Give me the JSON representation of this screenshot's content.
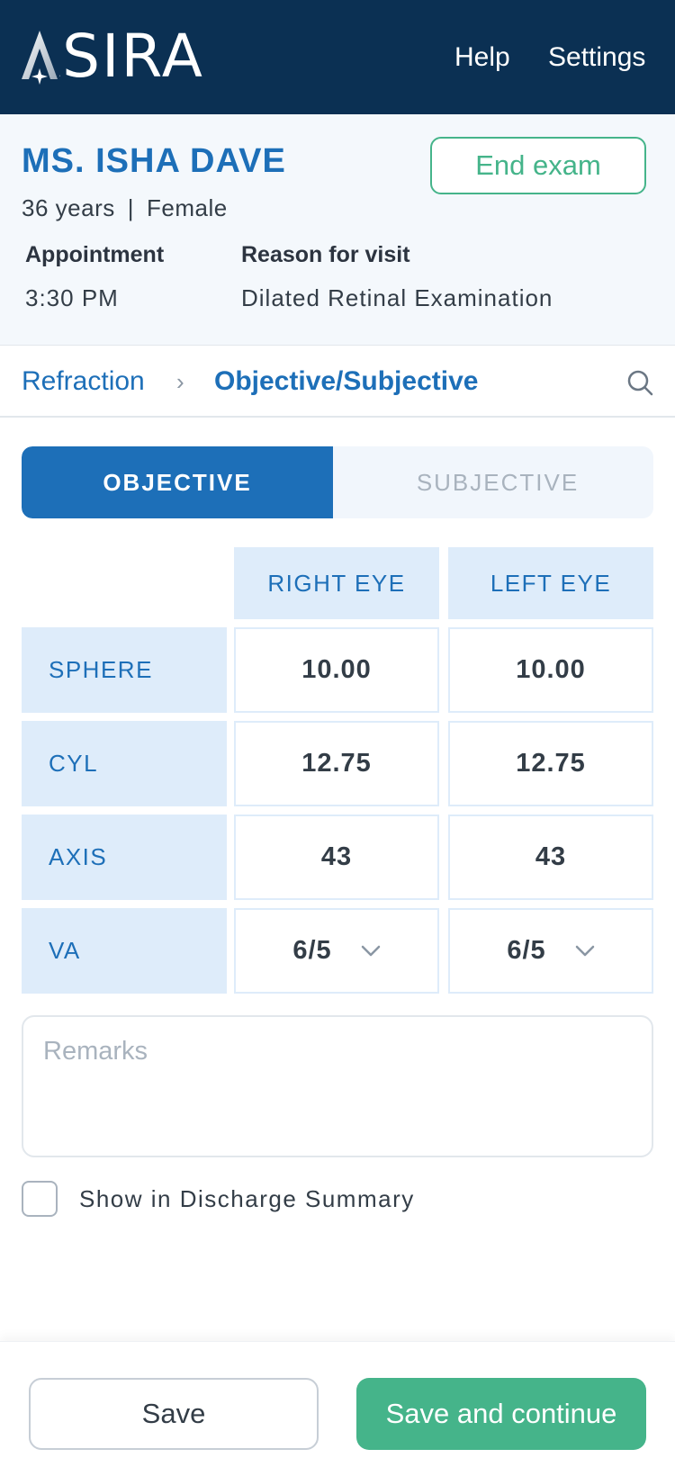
{
  "colors": {
    "header_bg": "#0b3053",
    "primary": "#1d6fb8",
    "accent_green": "#45b48a",
    "panel_bg": "#f4f8fc",
    "cell_bg": "#deecfa"
  },
  "header": {
    "logo_text": "ASIRA",
    "help_label": "Help",
    "settings_label": "Settings"
  },
  "patient": {
    "name": "MS. ISHA DAVE",
    "age": "36 years",
    "separator": "|",
    "gender": "Female",
    "end_exam_label": "End exam",
    "appointment_label": "Appointment",
    "appointment_value": "3:30 PM",
    "reason_label": "Reason for visit",
    "reason_value": "Dilated Retinal Examination"
  },
  "breadcrumb": {
    "parent": "Refraction",
    "separator": "›",
    "current": "Objective/Subjective",
    "search_icon": "search-icon"
  },
  "tabs": {
    "objective": "OBJECTIVE",
    "subjective": "SUBJECTIVE",
    "active": "objective"
  },
  "grid": {
    "columns": [
      "RIGHT EYE",
      "LEFT EYE"
    ],
    "rows": [
      {
        "label": "SPHERE",
        "right": "10.00",
        "left": "10.00"
      },
      {
        "label": "CYL",
        "right": "12.75",
        "left": "12.75"
      },
      {
        "label": "AXIS",
        "right": "43",
        "left": "43"
      },
      {
        "label": "VA",
        "right": "6/5",
        "left": "6/5"
      }
    ]
  },
  "remarks": {
    "placeholder": "Remarks",
    "value": ""
  },
  "discharge": {
    "label": "Show in Discharge Summary",
    "checked": false
  },
  "footer": {
    "save_label": "Save",
    "continue_label": "Save and continue"
  }
}
